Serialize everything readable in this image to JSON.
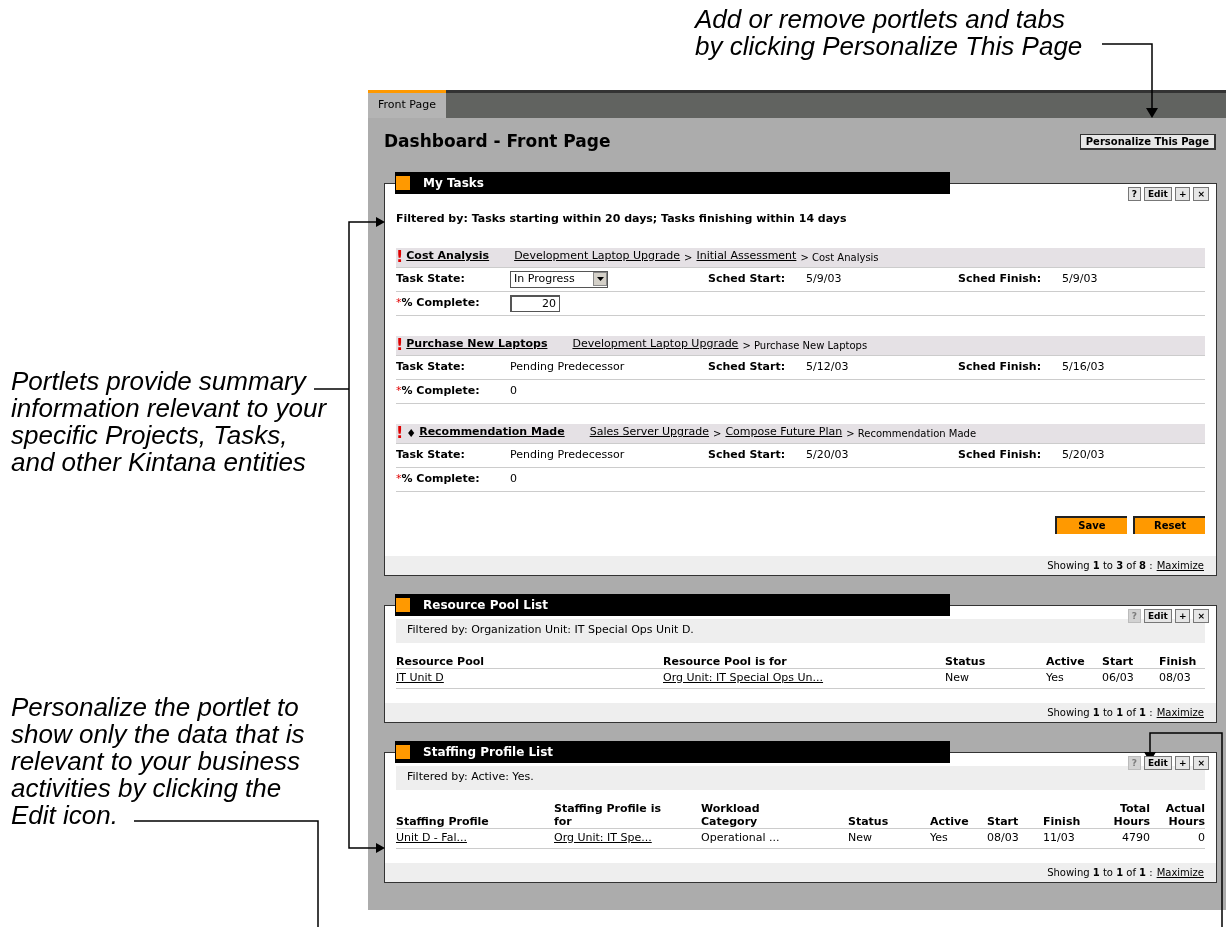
{
  "annotations": [
    {
      "text": "Add or remove portlets and tabs\nby clicking Personalize This Page"
    },
    {
      "text": "Portlets provide summary\ninformation relevant to your\nspecific Projects, Tasks,\nand other Kintana entities"
    },
    {
      "text": "Personalize the portlet to\nshow only the data that is\nrelevant to your business\nactivities by clicking the\nEdit icon."
    }
  ],
  "tabs": [
    {
      "label": "Front Page",
      "selected": true
    }
  ],
  "page_title": "Dashboard - Front Page",
  "personalize_button": "Personalize This Page",
  "portlets": [
    {
      "kind": "tasks",
      "title": "My Tasks",
      "controls": [
        {
          "label": "?",
          "disabled": false
        },
        {
          "label": "Edit",
          "disabled": false
        },
        {
          "label": "+",
          "disabled": false
        },
        {
          "label": "×",
          "disabled": false
        }
      ],
      "filter": "Filtered by: Tasks starting within 20 days; Tasks finishing within 14 days",
      "tasks": [
        {
          "markers": [
            "!"
          ],
          "name": "Cost Analysis",
          "path": [
            {
              "text": "Development Laptop Upgrade",
              "link": true
            },
            {
              "text": ">",
              "link": false
            },
            {
              "text": "Initial Assessment",
              "link": true
            },
            {
              "text": "> Cost Analysis",
              "link": false
            }
          ],
          "state_label": "Task State:",
          "state": {
            "kind": "dropdown",
            "value": "In Progress"
          },
          "start_label": "Sched Start:",
          "start": "5/9/03",
          "finish_label": "Sched Finish:",
          "finish": "5/9/03",
          "required_mark": "*",
          "complete_label": "% Complete:",
          "complete": {
            "kind": "input",
            "value": "20"
          }
        },
        {
          "markers": [
            "!"
          ],
          "name": "Purchase New Laptops",
          "path": [
            {
              "text": "Development Laptop Upgrade",
              "link": true
            },
            {
              "text": "> Purchase New Laptops",
              "link": false
            }
          ],
          "state_label": "Task State:",
          "state": {
            "kind": "text",
            "value": "Pending Predecessor"
          },
          "start_label": "Sched Start:",
          "start": "5/12/03",
          "finish_label": "Sched Finish:",
          "finish": "5/16/03",
          "required_mark": "*",
          "complete_label": "% Complete:",
          "complete": {
            "kind": "text",
            "value": "0"
          }
        },
        {
          "markers": [
            "!",
            "♦"
          ],
          "name": "Recommendation Made",
          "path": [
            {
              "text": "Sales Server Upgrade",
              "link": true
            },
            {
              "text": ">",
              "link": false
            },
            {
              "text": "Compose Future Plan",
              "link": true
            },
            {
              "text": "> Recommendation Made",
              "link": false
            }
          ],
          "state_label": "Task State:",
          "state": {
            "kind": "text",
            "value": "Pending Predecessor"
          },
          "start_label": "Sched Start:",
          "start": "5/20/03",
          "finish_label": "Sched Finish:",
          "finish": "5/20/03",
          "required_mark": "*",
          "complete_label": "% Complete:",
          "complete": {
            "kind": "text",
            "value": "0"
          }
        }
      ],
      "buttons": [
        "Save",
        "Reset"
      ],
      "footer": "Showing **1** to **3** of **8** :",
      "footer_link": "Maximize"
    },
    {
      "kind": "table",
      "title": "Resource Pool List",
      "controls": [
        {
          "label": "?",
          "disabled": true
        },
        {
          "label": "Edit",
          "disabled": false
        },
        {
          "label": "+",
          "disabled": false
        },
        {
          "label": "×",
          "disabled": false
        }
      ],
      "filter": "Filtered by: Organization Unit: IT Special Ops Unit D.",
      "columns": [
        {
          "label": "Resource Pool",
          "numeric": false
        },
        {
          "label": "Resource Pool is for",
          "numeric": false
        },
        {
          "label": "Status",
          "numeric": false
        },
        {
          "label": "Active",
          "numeric": false
        },
        {
          "label": "Start",
          "numeric": false
        },
        {
          "label": "Finish",
          "numeric": false
        }
      ],
      "rows": [
        [
          {
            "text": "IT Unit D",
            "link": true
          },
          {
            "text": "Org Unit: IT Special Ops Un...",
            "link": true
          },
          {
            "text": "New",
            "link": false
          },
          {
            "text": "Yes",
            "link": false
          },
          {
            "text": "06/03",
            "link": false
          },
          {
            "text": "08/03",
            "link": false
          }
        ]
      ],
      "footer": "Showing **1** to **1** of **1** :",
      "footer_link": "Maximize"
    },
    {
      "kind": "table",
      "title": "Staffing Profile List",
      "controls": [
        {
          "label": "?",
          "disabled": true
        },
        {
          "label": "Edit",
          "disabled": false
        },
        {
          "label": "+",
          "disabled": false
        },
        {
          "label": "×",
          "disabled": false
        }
      ],
      "filter": "Filtered by: Active: Yes.",
      "columns": [
        {
          "label": "Staffing Profile",
          "numeric": false
        },
        {
          "label": "Staffing Profile is\nfor",
          "numeric": false
        },
        {
          "label": "Workload\nCategory",
          "numeric": false
        },
        {
          "label": "Status",
          "numeric": false
        },
        {
          "label": "Active",
          "numeric": false
        },
        {
          "label": "Start",
          "numeric": false
        },
        {
          "label": "Finish",
          "numeric": false
        },
        {
          "label": "Total\nHours",
          "numeric": true
        },
        {
          "label": "Actual\nHours",
          "numeric": true
        }
      ],
      "rows": [
        [
          {
            "text": "Unit D - Fal...",
            "link": true
          },
          {
            "text": "Org Unit: IT Spe...",
            "link": true
          },
          {
            "text": "Operational ...",
            "link": false
          },
          {
            "text": "New",
            "link": false
          },
          {
            "text": "Yes",
            "link": false
          },
          {
            "text": "08/03",
            "link": false
          },
          {
            "text": "11/03",
            "link": false
          },
          {
            "text": "4790",
            "link": false
          },
          {
            "text": "0",
            "link": false
          }
        ]
      ],
      "footer": "Showing **1** to **1** of **1** :",
      "footer_link": "Maximize"
    }
  ]
}
